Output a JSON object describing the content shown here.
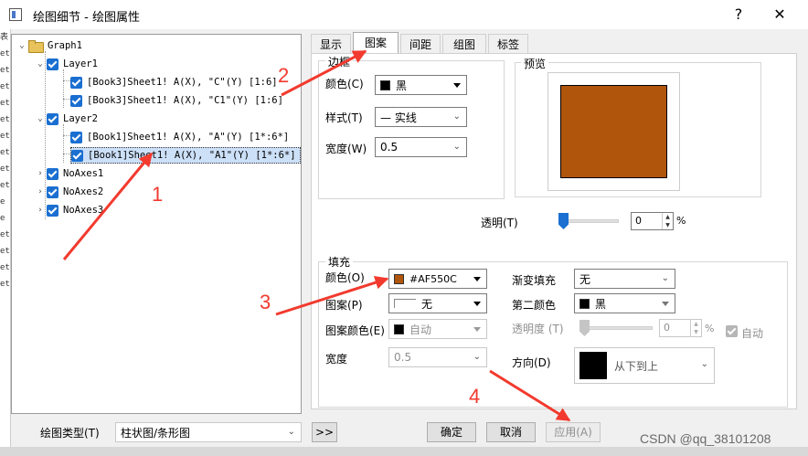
{
  "window": {
    "title": "绘图细节 - 绘图属性",
    "help_label": "?",
    "close_label": "✕"
  },
  "left_strip": {
    "chars": [
      "表",
      "et",
      "et",
      "et",
      "et",
      "et",
      "et",
      "et",
      "et",
      "et",
      "e",
      "e",
      "et",
      "et",
      "et",
      "et"
    ]
  },
  "tree": {
    "root": {
      "label": "Graph1",
      "expander": "⌄"
    },
    "items": [
      {
        "label": "Layer1",
        "expander": "⌄"
      },
      {
        "label": "[Book3]Sheet1! A(X), \"C\"(Y) [1:6]"
      },
      {
        "label": "[Book3]Sheet1! A(X), \"C1\"(Y) [1:6]"
      },
      {
        "label": "Layer2",
        "expander": "⌄"
      },
      {
        "label": "[Book1]Sheet1! A(X), \"A\"(Y) [1*:6*]"
      },
      {
        "label": "[Book1]Sheet1! A(X), \"A1\"(Y) [1*:6*]"
      },
      {
        "label": "NoAxes1",
        "expander": "›"
      },
      {
        "label": "NoAxes2",
        "expander": "›"
      },
      {
        "label": "NoAxes3",
        "expander": "›"
      }
    ]
  },
  "tabs": [
    "显示",
    "图案",
    "间距",
    "组图",
    "标签"
  ],
  "border": {
    "group_label": "边框",
    "color_label": "颜色(C)",
    "color_value": "黑",
    "color_hex": "#000000",
    "style_label": "样式(T)",
    "style_value": "— 实线",
    "width_label": "宽度(W)",
    "width_value": "0.5"
  },
  "preview": {
    "group_label": "预览",
    "fill_hex": "#AF550C"
  },
  "transparency": {
    "label": "透明(T)",
    "value": "0",
    "unit": "%",
    "level_percent": 0
  },
  "fill": {
    "group_label": "填充",
    "color_label": "颜色(O)",
    "color_value": "#AF550C",
    "color_hex": "#AF550C",
    "pattern_label": "图案(P)",
    "pattern_value": "无",
    "pattern_color_label": "图案颜色(E)",
    "pattern_color_value": "自动",
    "width_label": "宽度",
    "width_value": "0.5",
    "gradient_label": "渐变填充",
    "gradient_value": "无",
    "second_color_label": "第二颜色",
    "second_color_value": "黑",
    "second_color_hex": "#000000",
    "opacity_label": "透明度 (T)",
    "opacity_value": "0",
    "opacity_unit": "%",
    "auto_label": "自动",
    "direction_label": "方向(D)",
    "direction_value": "从下到上"
  },
  "footer": {
    "plot_type_label": "绘图类型(T)",
    "plot_type_value": "柱状图/条形图",
    "more_button": ">>",
    "ok_button": "确定",
    "cancel_button": "取消",
    "apply_button": "应用(A)"
  },
  "annotations": {
    "n1": "1",
    "n2": "2",
    "n3": "3",
    "n4": "4",
    "color": "#F23A2E"
  },
  "watermark": "CSDN @qq_38101208"
}
